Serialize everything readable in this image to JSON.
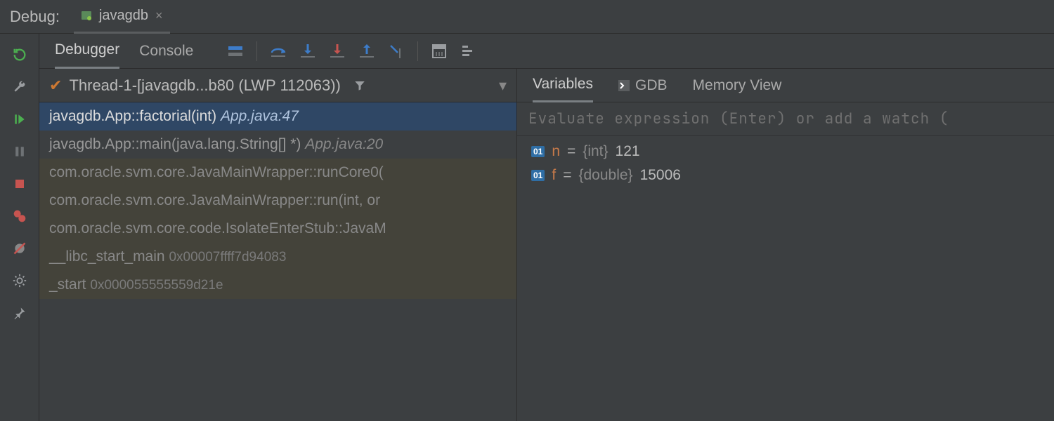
{
  "header": {
    "debug_label": "Debug:",
    "tab_name": "javagdb"
  },
  "tabs": {
    "debugger": "Debugger",
    "console": "Console"
  },
  "thread": "Thread-1-[javagdb...b80 (LWP 112063))",
  "frames": [
    {
      "sig": "javagdb.App::factorial(int)",
      "loc": "App.java:47",
      "selected": true
    },
    {
      "sig": "javagdb.App::main(java.lang.String[] *)",
      "loc": "App.java:20"
    },
    {
      "sig": "com.oracle.svm.core.JavaMainWrapper::runCore0(",
      "dim": true
    },
    {
      "sig": "com.oracle.svm.core.JavaMainWrapper::run(int, or",
      "dim": true
    },
    {
      "sig": "com.oracle.svm.core.code.IsolateEnterStub::JavaM",
      "dim": true
    },
    {
      "sig": "__libc_start_main",
      "addr": "0x00007ffff7d94083",
      "dim": true
    },
    {
      "sig": "_start",
      "addr": "0x000055555559d21e",
      "dim": true
    }
  ],
  "vars_tabs": {
    "variables": "Variables",
    "gdb": "GDB",
    "memory": "Memory View"
  },
  "eval_placeholder": "Evaluate expression (Enter) or add a watch (",
  "variables": [
    {
      "badge": "01",
      "name": "n",
      "type": "{int}",
      "value": "121"
    },
    {
      "badge": "01",
      "name": "f",
      "type": "{double}",
      "value": "15006"
    }
  ]
}
